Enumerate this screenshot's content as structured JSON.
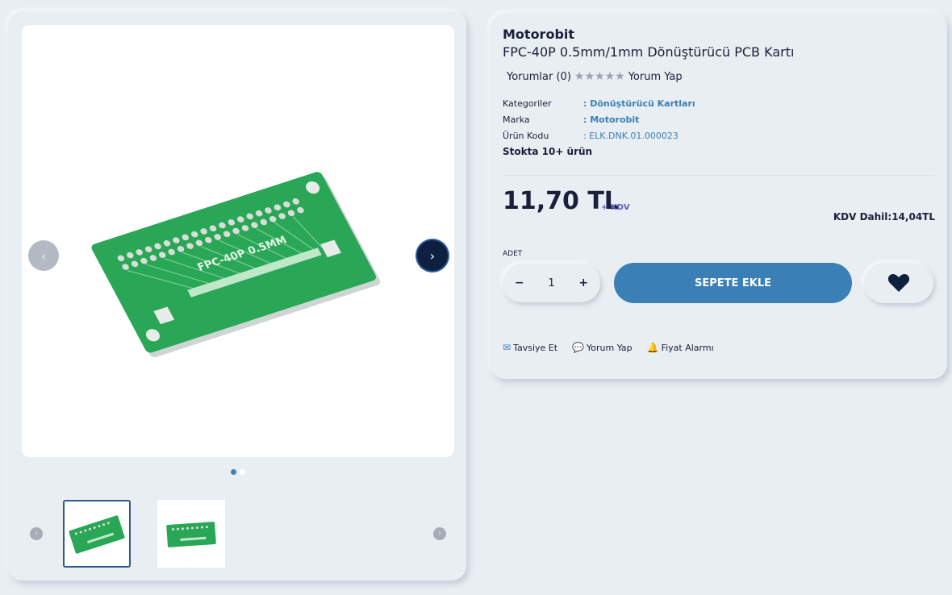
{
  "product": {
    "brand": "Motorobit",
    "title": "FPC-40P 0.5mm/1mm Dönüştürücü PCB Kartı",
    "reviews_label": "Yorumlar (0)",
    "rating": 0,
    "write_review": "Yorum Yap",
    "meta": [
      {
        "key": "Kategoriler",
        "value": ": Dönüştürücü Kartları"
      },
      {
        "key": "Marka",
        "value": ": Motorobit"
      },
      {
        "key": "Ürün Kodu",
        "value": ": ELK.DNK.01.000023"
      }
    ],
    "stock": "Stokta 10+ ürün",
    "price": "11,70 TL",
    "kdv_tag": "+ KDV",
    "kdv_total": "KDV Dahil:14,04TL",
    "qty_label": "ADET",
    "qty_value": "1",
    "qty_minus": "−",
    "qty_plus": "+",
    "add_to_cart": "SEPETE EKLE",
    "image_text": "FPC-40P 0.5MM"
  },
  "actions": [
    {
      "label": "Tavsiye Et",
      "icon": "mail-icon"
    },
    {
      "label": "Yorum Yap",
      "icon": "comment-icon"
    },
    {
      "label": "Fiyat Alarmı",
      "icon": "bell-icon"
    }
  ],
  "gallery": {
    "active_index": 0,
    "count": 2
  },
  "colors": {
    "accent": "#3a7fb5",
    "dark": "#0f1f3f",
    "background": "#e9eef3",
    "pcb_green": "#2aa756"
  }
}
